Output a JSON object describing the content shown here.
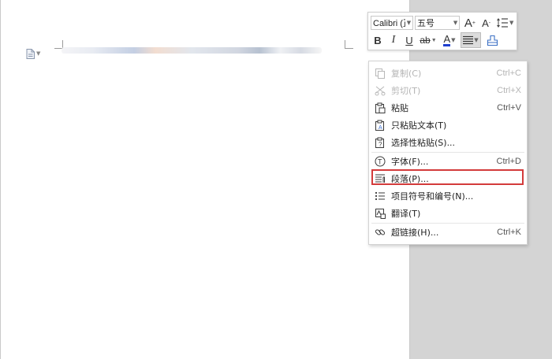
{
  "toolbar": {
    "font_name": "Calibri (正",
    "font_size": "五号",
    "grow_glyph": "A",
    "grow_sup": "+",
    "shrink_glyph": "A",
    "shrink_sup": "-",
    "bold": "B",
    "italic": "I",
    "underline": "U",
    "strike": "ab",
    "font_color_letter": "A",
    "font_color": "#1f3fcf"
  },
  "context_menu": {
    "items": [
      {
        "label": "复制(C)",
        "shortcut": "Ctrl+C",
        "icon": "copy-icon",
        "enabled": false
      },
      {
        "label": "剪切(T)",
        "shortcut": "Ctrl+X",
        "icon": "cut-icon",
        "enabled": false
      },
      {
        "label": "粘贴",
        "shortcut": "Ctrl+V",
        "icon": "paste-icon",
        "enabled": true
      },
      {
        "label": "只粘贴文本(T)",
        "shortcut": "",
        "icon": "paste-text-icon",
        "enabled": true
      },
      {
        "label": "选择性粘贴(S)...",
        "shortcut": "",
        "icon": "paste-special-icon",
        "enabled": true
      },
      {
        "label": "字体(F)...",
        "shortcut": "Ctrl+D",
        "icon": "font-icon",
        "enabled": true
      },
      {
        "label": "段落(P)...",
        "shortcut": "",
        "icon": "paragraph-icon",
        "enabled": true,
        "highlighted": true
      },
      {
        "label": "项目符号和编号(N)...",
        "shortcut": "",
        "icon": "bullets-icon",
        "enabled": true
      },
      {
        "label": "翻译(T)",
        "shortcut": "",
        "icon": "translate-icon",
        "enabled": true
      },
      {
        "label": "超链接(H)...",
        "shortcut": "Ctrl+K",
        "icon": "hyperlink-icon",
        "enabled": true
      }
    ]
  },
  "colors": {
    "highlight_border": "#d33b3b",
    "workspace_background": "#d4d4d4",
    "page_background": "#ffffff"
  }
}
